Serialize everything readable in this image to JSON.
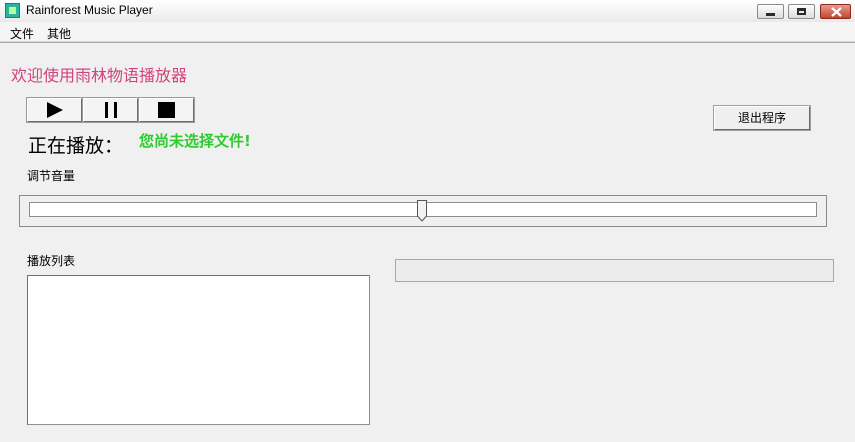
{
  "window": {
    "title": "Rainforest Music Player",
    "accent": "#d0447a"
  },
  "menu": {
    "file": "文件",
    "other": "其他"
  },
  "main": {
    "welcome": "欢迎使用雨林物语播放器",
    "now_playing_label": "正在播放：",
    "now_playing_status": "您尚未选择文件!",
    "exit_button": "退出程序",
    "volume_label": "调节音量",
    "volume_level": 0.5,
    "playlist_label": "播放列表",
    "playlist_items": [],
    "progress": 0
  },
  "controls": {
    "play_icon": "play-icon",
    "pause_icon": "pause-icon",
    "stop_icon": "stop-icon"
  },
  "colors": {
    "welcome_text": "#d0447a",
    "status_text": "#2ecc2e"
  }
}
